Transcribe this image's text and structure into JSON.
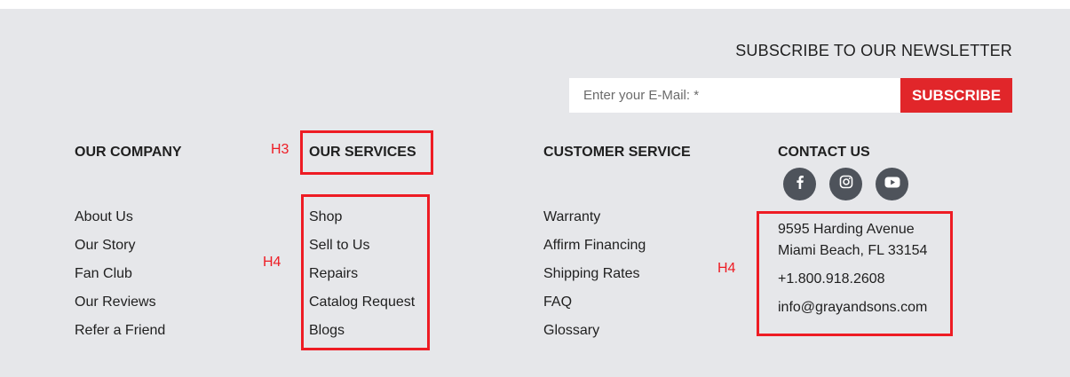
{
  "newsletter": {
    "title": "SUBSCRIBE TO OUR NEWSLETTER",
    "email_placeholder": "Enter your E-Mail: *",
    "subscribe_label": "SUBSCRIBE"
  },
  "columns": {
    "company": {
      "heading": "OUR COMPANY",
      "links": [
        "About Us",
        "Our Story",
        "Fan Club",
        "Our Reviews",
        "Refer a Friend"
      ]
    },
    "services": {
      "heading": "OUR SERVICES",
      "links": [
        "Shop",
        "Sell to Us",
        "Repairs",
        "Catalog Request",
        "Blogs"
      ]
    },
    "customer_service": {
      "heading": "CUSTOMER SERVICE",
      "links": [
        "Warranty",
        "Affirm Financing",
        "Shipping Rates",
        "FAQ",
        "Glossary"
      ]
    },
    "contact": {
      "heading": "CONTACT US",
      "social": [
        "facebook-icon",
        "instagram-icon",
        "youtube-icon"
      ],
      "address_line1": "9595 Harding Avenue",
      "address_line2": "Miami Beach, FL 33154",
      "phone": "+1.800.918.2608",
      "email": "info@grayandsons.com"
    }
  },
  "annotations": {
    "h3_label": "H3",
    "h4_label_services": "H4",
    "h4_label_contact": "H4",
    "color": "#ee1c24"
  },
  "colors": {
    "footer_bg": "#e6e7ea",
    "accent": "#e1262a",
    "social_bg": "#4e535b"
  }
}
